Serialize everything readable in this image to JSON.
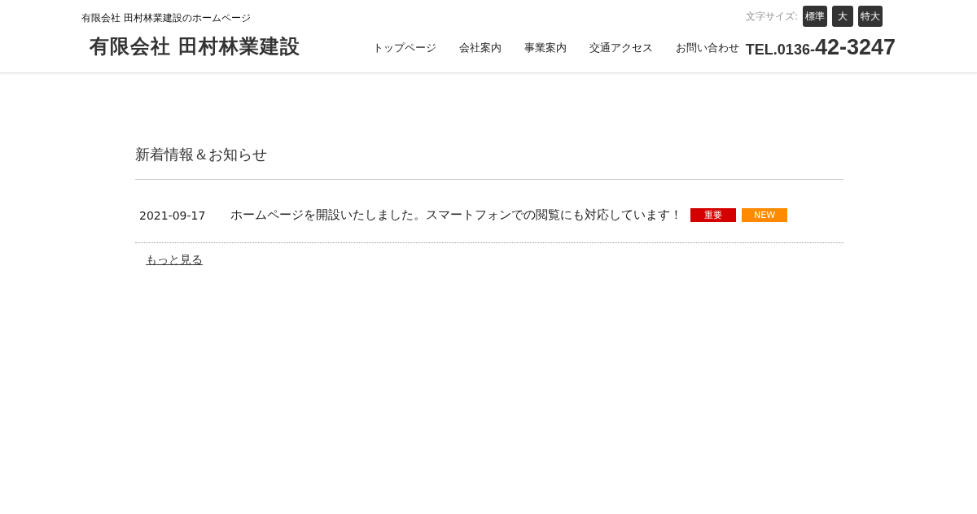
{
  "header": {
    "tagline": "有限会社 田村林業建設のホームページ",
    "logo": "有限会社 田村林業建設",
    "font_size_label": "文字サイズ:",
    "font_size_buttons": [
      "標準",
      "大",
      "特大"
    ],
    "nav": [
      "トップページ",
      "会社案内",
      "事業案内",
      "交通アクセス",
      "お問い合わせ"
    ],
    "tel_prefix": "TEL.0136-",
    "tel_number": "42-3247"
  },
  "news": {
    "title": "新着情報＆お知らせ",
    "items": [
      {
        "date": "2021-09-17",
        "text": "ホームページを開設いたしました。スマートフォンでの閲覧にも対応しています！",
        "tags": [
          {
            "label": "重要",
            "color": "#d40000"
          },
          {
            "label": "NEW",
            "color": "#ff8a00"
          }
        ]
      }
    ],
    "more_link": "もっと見る"
  }
}
